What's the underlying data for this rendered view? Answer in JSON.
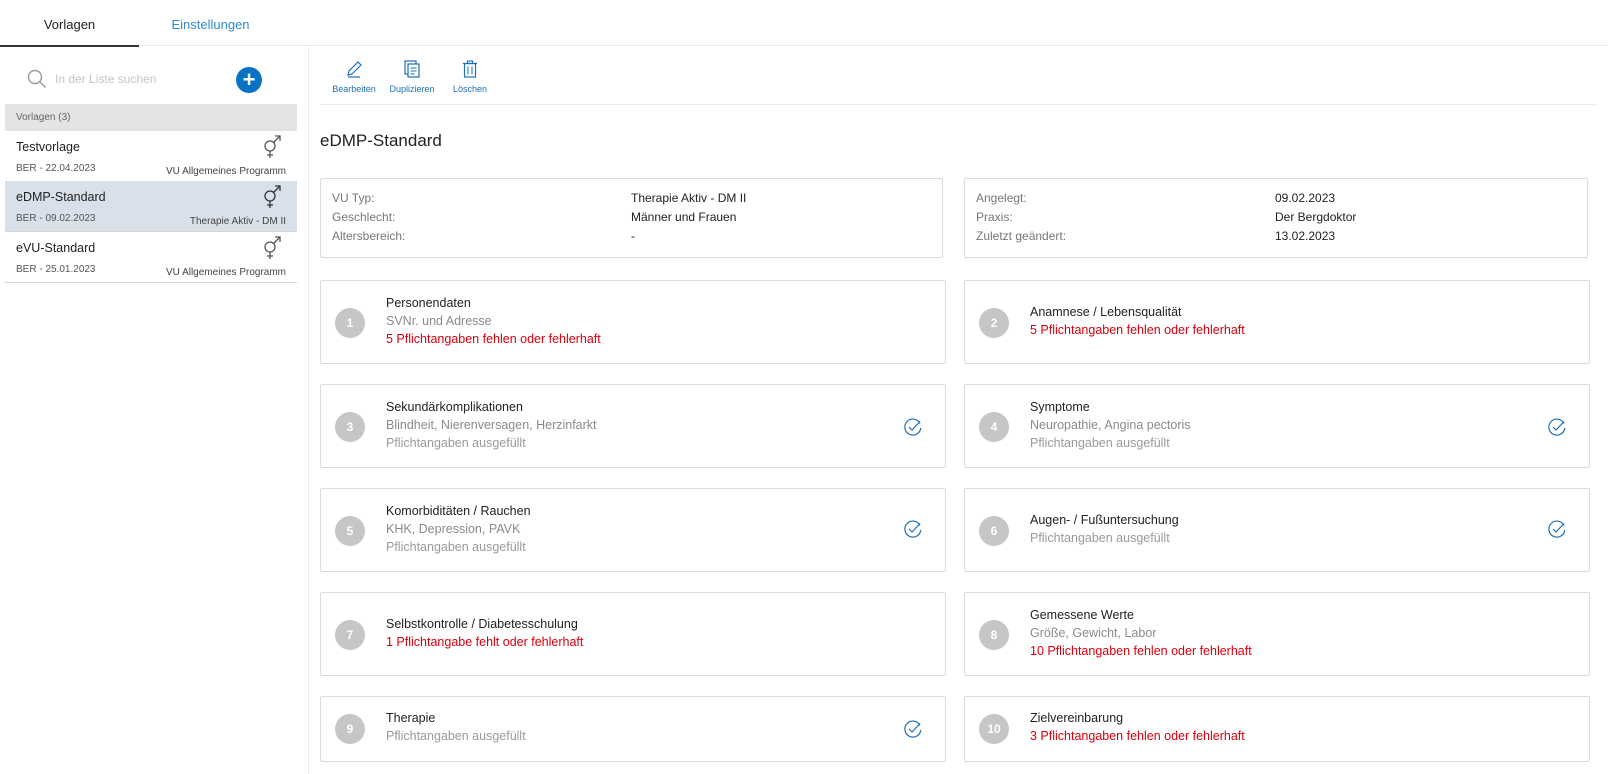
{
  "tabs": {
    "vorlagen": "Vorlagen",
    "einstellungen": "Einstellungen"
  },
  "sidebar": {
    "search_placeholder": "In der Liste suchen",
    "add_label": "+",
    "group_label": "Vorlagen (3)",
    "items": [
      {
        "title": "Testvorlage",
        "subtitle": "BER - 22.04.2023",
        "program": "VU Allgemeines Programm",
        "icon": "gender-male-female-icon"
      },
      {
        "title": "eDMP-Standard",
        "subtitle": "BER - 09.02.2023",
        "program": "Therapie Aktiv - DM II",
        "icon": "gender-male-female-icon",
        "selected": true
      },
      {
        "title": "eVU-Standard",
        "subtitle": "BER - 25.01.2023",
        "program": "VU Allgemeines Programm",
        "icon": "gender-male-female-icon"
      }
    ]
  },
  "toolbar": {
    "edit": "Bearbeiten",
    "duplicate": "Duplizieren",
    "delete": "Löschen"
  },
  "title": "eDMP-Standard",
  "info_left": {
    "vu_typ_label": "VU Typ:",
    "vu_typ": "Therapie Aktiv - DM II",
    "geschlecht_label": "Geschlecht:",
    "geschlecht": "Männer und Frauen",
    "alter_label": "Altersbereich:",
    "alter": "-"
  },
  "info_right": {
    "angelegt_label": "Angelegt:",
    "angelegt": "09.02.2023",
    "praxis_label": "Praxis:",
    "praxis": "Der Bergdoktor",
    "geaendert_label": "Zuletzt geändert:",
    "geaendert": "13.02.2023"
  },
  "sections": [
    {
      "num": "1",
      "title": "Personendaten",
      "subtitle": "SVNr. und Adresse",
      "status": "5 Pflichtangaben fehlen oder fehlerhaft",
      "ok": false
    },
    {
      "num": "2",
      "title": "Anamnese / Lebensqualität",
      "subtitle": "",
      "status": "5 Pflichtangaben fehlen oder fehlerhaft",
      "ok": false
    },
    {
      "num": "3",
      "title": "Sekundärkomplikationen",
      "subtitle": "Blindheit, Nierenversagen, Herzinfarkt",
      "status": "Pflichtangaben ausgefüllt",
      "ok": true
    },
    {
      "num": "4",
      "title": "Symptome",
      "subtitle": "Neuropathie, Angina pectoris",
      "status": "Pflichtangaben ausgefüllt",
      "ok": true
    },
    {
      "num": "5",
      "title": "Komorbiditäten / Rauchen",
      "subtitle": "KHK, Depression, PAVK",
      "status": "Pflichtangaben ausgefüllt",
      "ok": true
    },
    {
      "num": "6",
      "title": "Augen- / Fußuntersuchung",
      "subtitle": "",
      "status": "Pflichtangaben ausgefüllt",
      "ok": true
    },
    {
      "num": "7",
      "title": "Selbstkontrolle / Diabetesschulung",
      "subtitle": "",
      "status": "1 Pflichtangabe fehlt oder fehlerhaft",
      "ok": false
    },
    {
      "num": "8",
      "title": "Gemessene Werte",
      "subtitle": "Größe, Gewicht, Labor",
      "status": "10 Pflichtangaben fehlen oder fehlerhaft",
      "ok": false
    },
    {
      "num": "9",
      "title": "Therapie",
      "subtitle": "",
      "status": "Pflichtangaben ausgefüllt",
      "ok": true
    },
    {
      "num": "10",
      "title": "Zielvereinbarung",
      "subtitle": "",
      "status": "3 Pflichtangaben fehlen oder fehlerhaft",
      "ok": false
    }
  ],
  "colors": {
    "accent": "#0a72c2",
    "link": "#2f8ad6",
    "error": "#d9000d",
    "selected_bg": "#d8e0ea",
    "badge": "#c6c6c6"
  }
}
